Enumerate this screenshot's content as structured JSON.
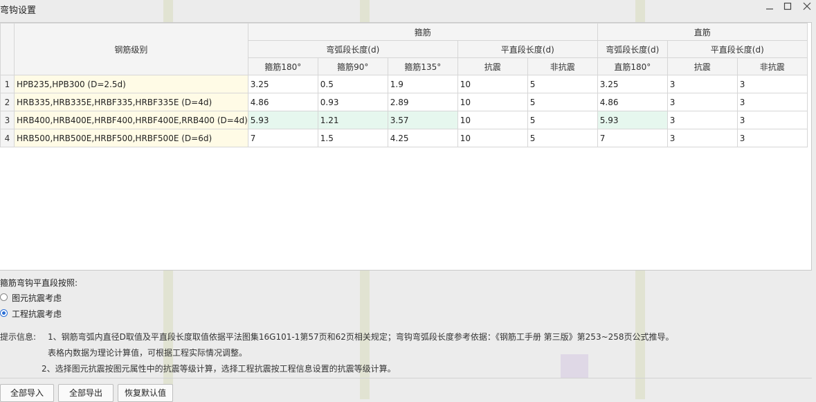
{
  "window": {
    "title": "弯钩设置"
  },
  "table": {
    "header_grade": "钢筋级别",
    "group_stirrup": "箍筋",
    "group_straight": "直筋",
    "sub_arc_len": "弯弧段长度(d)",
    "sub_flat_len": "平直段长度(d)",
    "sub_arc_len_straight": "弯弧段长度(d)",
    "sub_flat_len_straight": "平直段长度(d)",
    "cols": [
      "箍筋180°",
      "箍筋90°",
      "箍筋135°",
      "抗震",
      "非抗震",
      "直筋180°",
      "抗震",
      "非抗震"
    ],
    "rows": [
      {
        "num": "1",
        "grade": "HPB235,HPB300 (D=2.5d)",
        "cells": [
          "3.25",
          "0.5",
          "1.9",
          "10",
          "5",
          "3.25",
          "3",
          "3"
        ]
      },
      {
        "num": "2",
        "grade": "HRB335,HRB335E,HRBF335,HRBF335E (D=4d)",
        "cells": [
          "4.86",
          "0.93",
          "2.89",
          "10",
          "5",
          "4.86",
          "3",
          "3"
        ]
      },
      {
        "num": "3",
        "grade": "HRB400,HRB400E,HRBF400,HRBF400E,RRB400 (D=4d)",
        "cells": [
          "5.93",
          "1.21",
          "3.57",
          "10",
          "5",
          "5.93",
          "3",
          "3"
        ]
      },
      {
        "num": "4",
        "grade": "HRB500,HRB500E,HRBF500,HRBF500E (D=6d)",
        "cells": [
          "7",
          "1.5",
          "4.25",
          "10",
          "5",
          "7",
          "3",
          "3"
        ]
      }
    ]
  },
  "options": {
    "heading": "箍筋弯钩平直段按照:",
    "opt1": "图元抗震考虑",
    "opt2": "工程抗震考虑",
    "selected": "工程抗震考虑"
  },
  "hint": {
    "label": "提示信息:",
    "line1": "1、钢筋弯弧内直径D取值及平直段长度取值依据平法图集16G101-1第57页和62页相关规定；弯钩弯弧段长度参考依据：《钢筋工手册  第三版》第253~258页公式推导。",
    "line2": "表格内数据为理论计算值，可根据工程实际情况调整。",
    "line3": "2、选择图元抗震按图元属性中的抗震等级计算，选择工程抗震按工程信息设置的抗震等级计算。"
  },
  "buttons": {
    "import_all": "全部导入",
    "export_all": "全部导出",
    "restore_default": "恢复默认值"
  }
}
